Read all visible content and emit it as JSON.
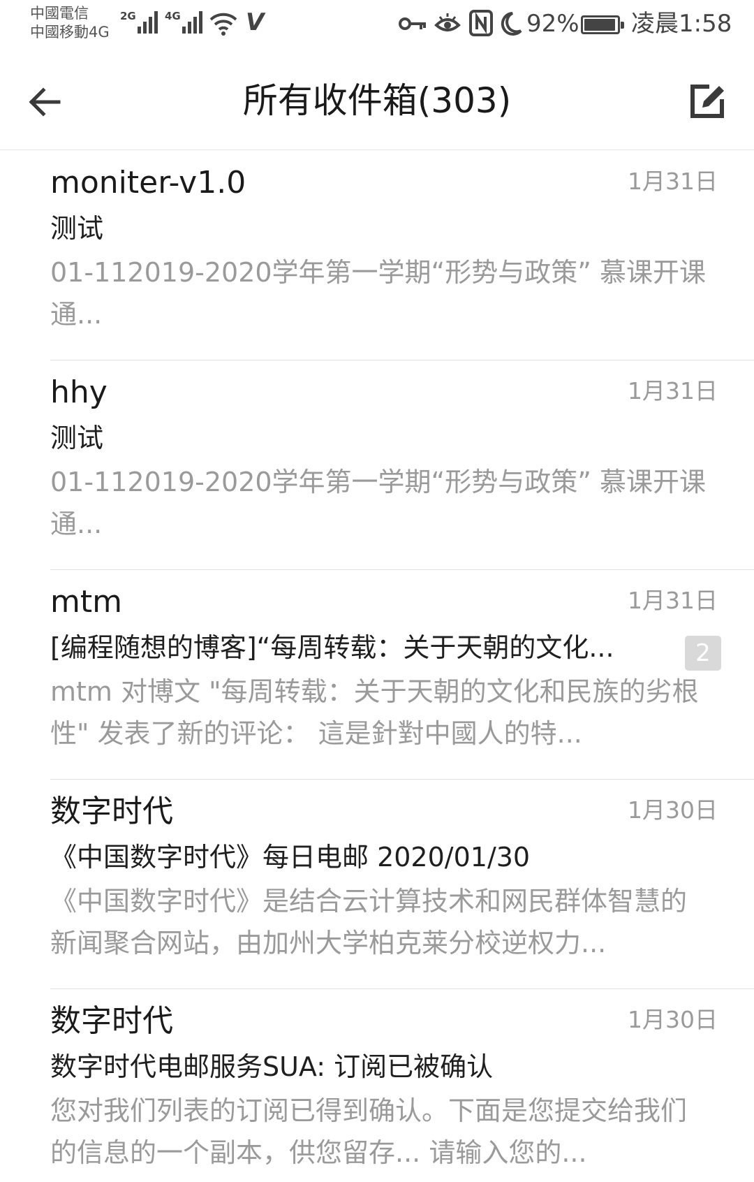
{
  "status_bar": {
    "carrier_1": "中國電信",
    "carrier_2": "中國移動4G",
    "sig1_gen": "2G",
    "sig2_gen": "4G",
    "battery": "92%",
    "time": "凌晨1:58",
    "icons": [
      "signal-icon",
      "wifi-icon",
      "vpn-icon",
      "key-icon",
      "eye-icon",
      "nfc-icon",
      "moon-icon",
      "battery-icon"
    ]
  },
  "header": {
    "title": "所有收件箱(303)",
    "back_icon": "back-arrow-icon",
    "compose_icon": "compose-icon"
  },
  "mails": [
    {
      "sender": "moniter-v1.0",
      "date": "1月31日",
      "subject": "测试",
      "preview": "01-112019-2020学年第一学期“形势与政策” 慕课开课通...",
      "count": ""
    },
    {
      "sender": "hhy",
      "date": "1月31日",
      "subject": "测试",
      "preview": "01-112019-2020学年第一学期“形势与政策” 慕课开课通...",
      "count": ""
    },
    {
      "sender": "mtm",
      "date": "1月31日",
      "subject": "[编程随想的博客]“每周转载：关于天朝的文化...",
      "preview": "mtm  对博文 \"每周转载：关于天朝的文化和民族的劣根性\" 发表了新的评论：     這是針對中國人的特...",
      "count": "2"
    },
    {
      "sender": "数字时代",
      "date": "1月30日",
      "subject": "《中国数字时代》每日电邮  2020/01/30",
      "preview": "《中国数字时代》是结合云计算技术和网民群体智慧的新闻聚合网站，由加州大学柏克莱分校逆权力...",
      "count": ""
    },
    {
      "sender": "数字时代",
      "date": "1月30日",
      "subject": "数字时代电邮服务SUA: 订阅已被确认",
      "preview": "您对我们列表的订阅已得到确认。下面是您提交给我们的信息的一个副本，供您留存... 请输入您的...",
      "count": ""
    }
  ]
}
